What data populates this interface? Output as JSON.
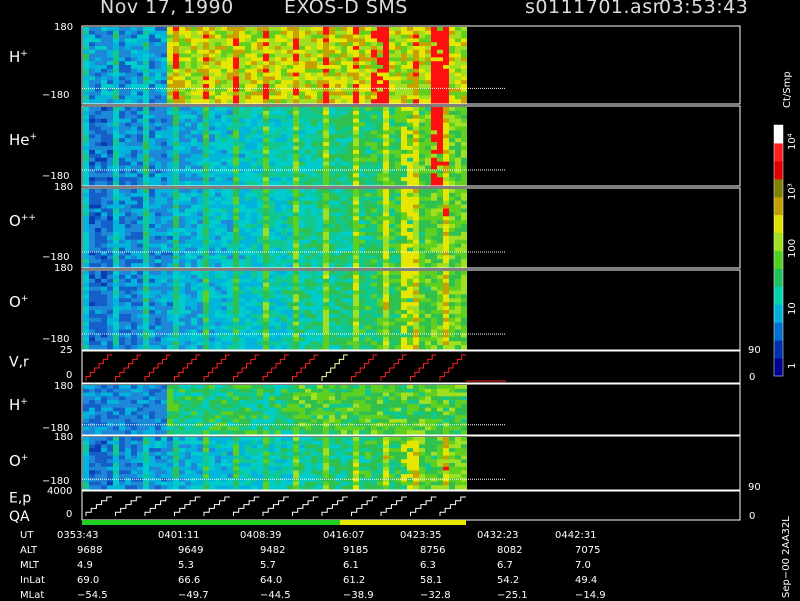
{
  "header": {
    "date": "Nov 17, 1990",
    "instrument": "EXOS-D SMS",
    "file": "s0111701.asr",
    "time": "03:53:43"
  },
  "panels": [
    {
      "species": "H",
      "charge": "+",
      "ymax": "180",
      "ymin": "−180"
    },
    {
      "species": "He",
      "charge": "+",
      "ymax": "180",
      "ymin": "−180"
    },
    {
      "species": "O",
      "charge": "++",
      "ymax": "180",
      "ymin": "−180"
    },
    {
      "species": "O",
      "charge": "+",
      "ymax": "180",
      "ymin": "−180"
    },
    {
      "species": "V,r",
      "charge": "",
      "ymax": "25",
      "ymin": "0",
      "right_top": "90",
      "right_bottom": "0"
    },
    {
      "species": "H",
      "charge": "+",
      "ymax": "180",
      "ymin": "−180"
    },
    {
      "species": "O",
      "charge": "+",
      "ymax": "180",
      "ymin": "−180"
    },
    {
      "species": "E,p",
      "charge": "",
      "ymax": "4000",
      "ymin": "0",
      "right_top": "90",
      "right_bottom": "0"
    }
  ],
  "qa_label": "QA",
  "colorbar": {
    "unit": "Ct/Smp",
    "tick_labels": [
      "1",
      "10",
      "100",
      "10³",
      "10⁴"
    ],
    "colors": [
      "#000090",
      "#0030b0",
      "#0070d0",
      "#00b0d8",
      "#00d0b0",
      "#20c060",
      "#50d020",
      "#a0e020",
      "#e0e000",
      "#c0a000",
      "#808000",
      "#e00000",
      "#ff2020",
      "#ffffff"
    ]
  },
  "footer": {
    "rows": [
      {
        "label": "UT",
        "values": [
          "0353:43",
          "0401:11",
          "0408:39",
          "0416:07",
          "0423:35",
          "0432:23",
          "0442:31"
        ]
      },
      {
        "label": "ALT",
        "values": [
          "9688",
          "9649",
          "9482",
          "9185",
          "8756",
          "8082",
          "7075"
        ]
      },
      {
        "label": "MLT",
        "values": [
          "4.9",
          "5.3",
          "5.7",
          "6.1",
          "6.3",
          "6.7",
          "7.0"
        ]
      },
      {
        "label": "InLat",
        "values": [
          "69.0",
          "66.6",
          "64.0",
          "61.2",
          "58.1",
          "54.2",
          "49.4"
        ]
      },
      {
        "label": "MLat",
        "values": [
          "−54.5",
          "−49.7",
          "−44.5",
          "−38.9",
          "−32.8",
          "−25.1",
          "−14.9"
        ]
      }
    ],
    "side_label": "Sep−00 2AA32L"
  },
  "chart_data": {
    "type": "heatmap",
    "x": [
      "0353:43",
      "0401:11",
      "0408:39",
      "0416:07",
      "0423:35",
      "0432:23",
      "0442:31"
    ],
    "xlabel": "UT",
    "panel_ylim": [
      [
        -180,
        180
      ],
      [
        -180,
        180
      ],
      [
        -180,
        180
      ],
      [
        -180,
        180
      ],
      [
        0,
        25
      ],
      [
        -180,
        180
      ],
      [
        -180,
        180
      ],
      [
        0,
        4000
      ]
    ],
    "colorscale_labels": [
      "1",
      "10",
      "100",
      "10³",
      "10⁴"
    ],
    "colorscale_unit": "Ct/Smp",
    "data_coverage_fraction": 0.48,
    "legend": "right"
  }
}
